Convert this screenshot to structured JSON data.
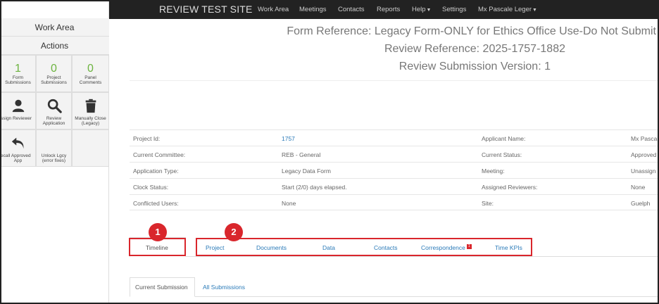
{
  "navbar": {
    "brand": "REVIEW TEST SITE",
    "items": [
      "Work Area",
      "Meetings",
      "Contacts",
      "Reports",
      "Help",
      "Settings",
      "Mx Pascale Leger"
    ]
  },
  "sidebar": {
    "work_area": "Work Area",
    "actions": "Actions",
    "tiles": [
      {
        "num": "1",
        "label1": "Form",
        "label2": "Submissions"
      },
      {
        "num": "0",
        "label1": "Project",
        "label2": "Submissions"
      },
      {
        "num": "0",
        "label1": "Panel",
        "label2": "Comments"
      },
      {
        "label1": "ssign Reviewer",
        "label2": "",
        "icon": "user-icon"
      },
      {
        "label1": "Review",
        "label2": "Application",
        "icon": "search-icon"
      },
      {
        "label1": "Manually Close",
        "label2": "(Legacy)",
        "icon": "trash-icon"
      },
      {
        "label1": "ecall Approved",
        "label2": "App",
        "icon": "undo-icon"
      },
      {
        "label1": "Unlock Lgcy",
        "label2": "(error fixes)"
      }
    ]
  },
  "header": {
    "form_reference": "Form Reference: Legacy Form-ONLY for Ethics Office Use-Do Not Submit",
    "review_reference": "Review Reference: 2025-1757-1882",
    "review_version": "Review Submission Version: 1"
  },
  "info": [
    {
      "l1": "Project Id:",
      "v1": "1757",
      "l2": "Applicant Name:",
      "v2": "Mx Pascal"
    },
    {
      "l1": "Current Committee:",
      "v1": "REB - General",
      "l2": "Current Status:",
      "v2": "Approved"
    },
    {
      "l1": "Application Type:",
      "v1": "Legacy Data Form",
      "l2": "Meeting:",
      "v2": "Unassign"
    },
    {
      "l1": "Clock Status:",
      "v1": "Start (2/0) days elapsed.",
      "l2": "Assigned Reviewers:",
      "v2": "None"
    },
    {
      "l1": "Conflicted Users:",
      "v1": "None",
      "l2": "Site:",
      "v2": "Guelph"
    }
  ],
  "tabs": {
    "timeline": "Timeline",
    "project": "Project",
    "documents": "Documents",
    "data": "Data",
    "contacts": "Contacts",
    "correspondence": "Correspondence",
    "correspondence_badge": "1",
    "time_kpis": "Time KPIs"
  },
  "callouts": [
    "1",
    "2"
  ],
  "subtabs": {
    "current": "Current Submission",
    "all": "All Submissions"
  },
  "colors": {
    "accent": "#2a7ab8",
    "callout": "#d9262c",
    "count": "#6cb33f",
    "nav_bg": "#222222"
  }
}
